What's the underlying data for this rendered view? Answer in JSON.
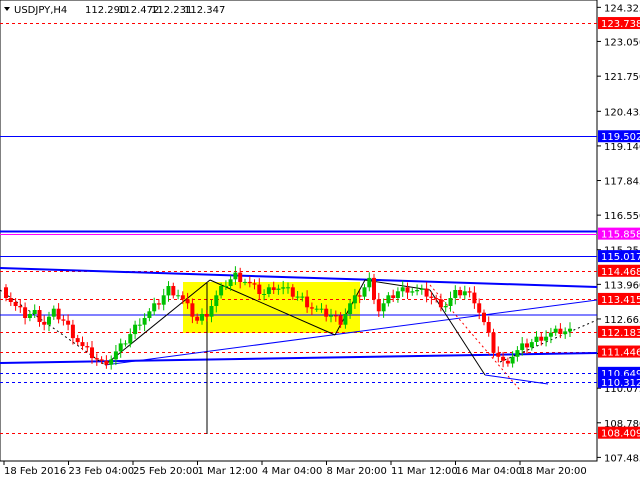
{
  "header": {
    "symbol": "USDJPY,H4",
    "open": "112.290",
    "high": "112.472",
    "low": "112.231",
    "close": "112.347"
  },
  "chart_data": {
    "type": "candlestick",
    "symbol": "USDJPY",
    "timeframe": "H4",
    "ylim": [
      107.35,
      124.6
    ],
    "y_ticks": [
      "124.325",
      "123.050",
      "121.750",
      "120.435",
      "119.140",
      "117.845",
      "116.550",
      "115.255",
      "113.960",
      "112.665",
      "111.370",
      "110.075",
      "108.780",
      "107.485"
    ],
    "x_ticks": [
      "18 Feb 2016",
      "23 Feb 04:00",
      "25 Feb 20:00",
      "1 Mar 12:00",
      "4 Mar 04:00",
      "8 Mar 20:00",
      "11 Mar 12:00",
      "16 Mar 04:00",
      "18 Mar 20:00"
    ],
    "levels": [
      {
        "label": "123.738",
        "value": 123.738,
        "color": "#ff0000",
        "style": "dashed"
      },
      {
        "label": "119.502",
        "value": 119.502,
        "color": "#0000ff",
        "style": "solid"
      },
      {
        "label": "115.858",
        "value": 115.858,
        "color": "#ff00ff",
        "style": "solid"
      },
      {
        "label": "115.017",
        "value": 115.017,
        "color": "#0000ff",
        "style": "solid"
      },
      {
        "label": "114.468",
        "value": 114.468,
        "color": "#ff0000",
        "style": "dashed"
      },
      {
        "label": "113.415",
        "value": 113.415,
        "color": "#ff0000",
        "style": "dashed"
      },
      {
        "label": "112.183",
        "value": 112.183,
        "color": "#ff0000",
        "style": "dashed"
      },
      {
        "label": "111.446",
        "value": 111.446,
        "color": "#ff0000",
        "style": "dashed"
      },
      {
        "label": "110.649",
        "value": 110.649,
        "color": "#0000ff",
        "style": "dashed"
      },
      {
        "label": "110.312",
        "value": 110.312,
        "color": "#0000ff",
        "style": "dashed"
      },
      {
        "label": "108.409",
        "value": 108.409,
        "color": "#ff0000",
        "style": "dashed"
      }
    ],
    "close_path": [
      113.6,
      113.1,
      112.8,
      112.9,
      112.5,
      112.9,
      112.6,
      112.1,
      111.6,
      111.3,
      111.0,
      111.2,
      111.6,
      112.1,
      112.6,
      112.9,
      113.3,
      113.8,
      113.6,
      113.1,
      112.6,
      112.9,
      113.5,
      114.0,
      114.3,
      114.1,
      113.8,
      113.6,
      113.9,
      113.8,
      113.6,
      113.4,
      113.1,
      112.9,
      112.8,
      112.6,
      113.2,
      113.6,
      114.1,
      113.0,
      113.4,
      113.7,
      113.8,
      113.7,
      113.6,
      113.3,
      113.2,
      113.6,
      113.7,
      113.4,
      112.5,
      111.5,
      111.0,
      111.3,
      111.6,
      111.8,
      112.0,
      112.1,
      112.2,
      112.2
    ],
    "colors": {
      "up": "#00c000",
      "down": "#ff0000",
      "highlight": "#ffff00"
    }
  }
}
